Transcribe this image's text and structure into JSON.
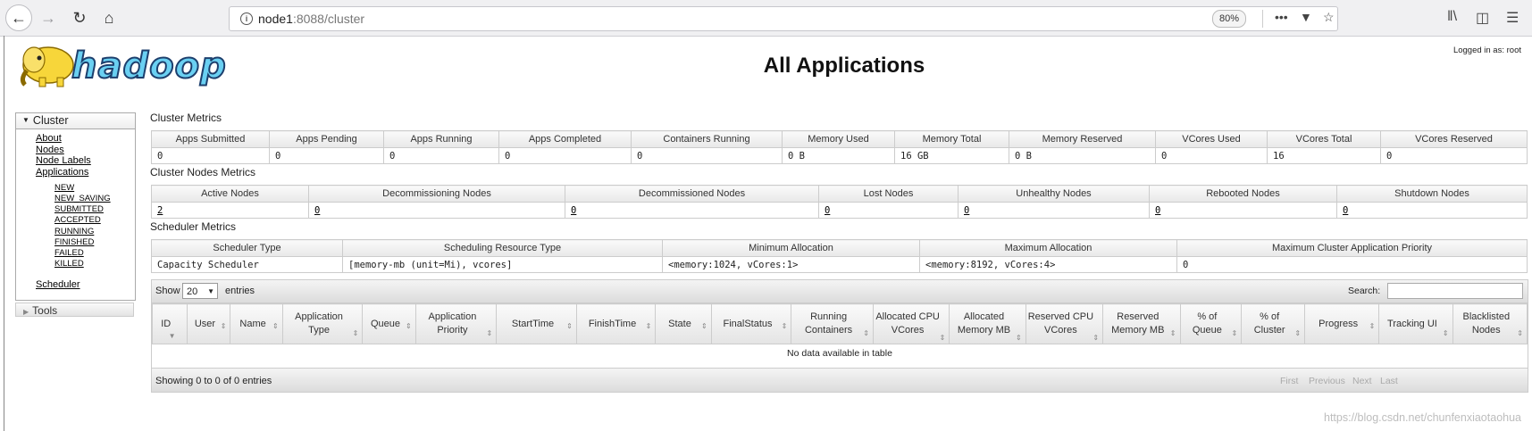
{
  "browser": {
    "url_host": "node1",
    "url_rest": ":8088/cluster",
    "zoom": "80%"
  },
  "header": {
    "logo_text": "hadoop",
    "title": "All Applications",
    "login": "Logged in as: root"
  },
  "sidebar": {
    "cluster_label": "Cluster",
    "links": [
      "About",
      "Nodes",
      "Node Labels",
      "Applications"
    ],
    "app_states": [
      "NEW",
      "NEW_SAVING",
      "SUBMITTED",
      "ACCEPTED",
      "RUNNING",
      "FINISHED",
      "FAILED",
      "KILLED"
    ],
    "scheduler_label": "Scheduler",
    "tools_label": "Tools"
  },
  "cluster_metrics": {
    "title": "Cluster Metrics",
    "headers": [
      "Apps Submitted",
      "Apps Pending",
      "Apps Running",
      "Apps Completed",
      "Containers Running",
      "Memory Used",
      "Memory Total",
      "Memory Reserved",
      "VCores Used",
      "VCores Total",
      "VCores Reserved"
    ],
    "values": [
      "0",
      "0",
      "0",
      "0",
      "0",
      "0 B",
      "16 GB",
      "0 B",
      "0",
      "16",
      "0"
    ]
  },
  "nodes_metrics": {
    "title": "Cluster Nodes Metrics",
    "headers": [
      "Active Nodes",
      "Decommissioning Nodes",
      "Decommissioned Nodes",
      "Lost Nodes",
      "Unhealthy Nodes",
      "Rebooted Nodes",
      "Shutdown Nodes"
    ],
    "values": [
      "2",
      "0",
      "0",
      "0",
      "0",
      "0",
      "0"
    ]
  },
  "scheduler_metrics": {
    "title": "Scheduler Metrics",
    "headers": [
      "Scheduler Type",
      "Scheduling Resource Type",
      "Minimum Allocation",
      "Maximum Allocation",
      "Maximum Cluster Application Priority"
    ],
    "values": [
      "Capacity Scheduler",
      "[memory-mb (unit=Mi), vcores]",
      "<memory:1024, vCores:1>",
      "<memory:8192, vCores:4>",
      "0"
    ]
  },
  "apps_table": {
    "show_label": "Show",
    "length_value": "20",
    "entries_label": "entries",
    "search_label": "Search:",
    "headers": [
      "ID",
      "User",
      "Name",
      "Application Type",
      "Queue",
      "Application Priority",
      "StartTime",
      "FinishTime",
      "State",
      "FinalStatus",
      "Running Containers",
      "Allocated CPU VCores",
      "Allocated Memory MB",
      "Reserved CPU VCores",
      "Reserved Memory MB",
      "% of Queue",
      "% of Cluster",
      "Progress",
      "Tracking UI",
      "Blacklisted Nodes"
    ],
    "empty_message": "No data available in table",
    "info": "Showing 0 to 0 of 0 entries",
    "pager": [
      "First",
      "Previous",
      "Next",
      "Last"
    ]
  },
  "watermark": "https://blog.csdn.net/chunfenxiaotaohua"
}
